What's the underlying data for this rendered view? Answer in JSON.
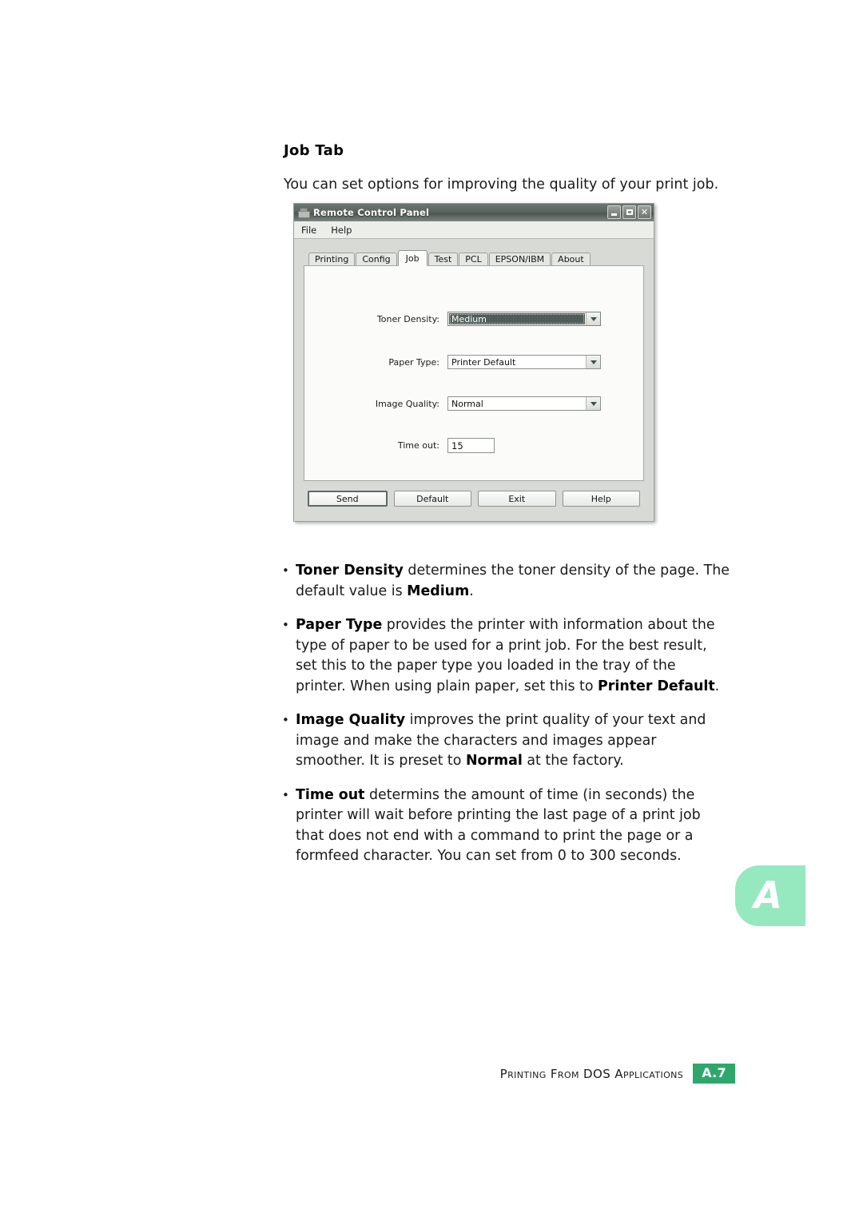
{
  "page": {
    "heading": "Job Tab",
    "intro": "You can set options for improving the quality of your print job."
  },
  "dialog": {
    "title": "Remote Control Panel",
    "title_icon": "printer-icon",
    "window_controls": {
      "minimize": "–",
      "maximize": "□",
      "close": "✕"
    },
    "menu": [
      {
        "label": "File"
      },
      {
        "label": "Help"
      }
    ],
    "tabs": [
      {
        "label": "Printing",
        "active": false
      },
      {
        "label": "Config",
        "active": false
      },
      {
        "label": "Job",
        "active": true
      },
      {
        "label": "Test",
        "active": false
      },
      {
        "label": "PCL",
        "active": false
      },
      {
        "label": "EPSON/IBM",
        "active": false
      },
      {
        "label": "About",
        "active": false
      }
    ],
    "fields": {
      "toner_density": {
        "label": "Toner Density:",
        "value": "Medium",
        "type": "dropdown",
        "focused": true
      },
      "paper_type": {
        "label": "Paper Type:",
        "value": "Printer Default",
        "type": "dropdown",
        "focused": false
      },
      "image_quality": {
        "label": "Image Quality:",
        "value": "Normal",
        "type": "dropdown",
        "focused": false
      },
      "time_out": {
        "label": "Time out:",
        "value": "15",
        "type": "text"
      }
    },
    "buttons": [
      {
        "label": "Send",
        "default": true
      },
      {
        "label": "Default",
        "default": false
      },
      {
        "label": "Exit",
        "default": false
      },
      {
        "label": "Help",
        "default": false
      }
    ]
  },
  "bullets": [
    {
      "id": "toner-density",
      "term": "Toner Density",
      "rest_1": " determines the toner density of the page. The default value is ",
      "term_2": "Medium",
      "rest_2": "."
    },
    {
      "id": "paper-type",
      "term": "Paper Type",
      "rest_1": " provides the printer with information about the type of paper to be used for a print job. For the best result, set this to the paper type you loaded in the tray of the printer. When using plain paper, set this to ",
      "term_2": "Printer Default",
      "rest_2": "."
    },
    {
      "id": "image-quality",
      "term": "Image Quality",
      "rest_1": " improves the print quality of your text and image and make the characters and images appear smoother. It is preset to ",
      "term_2": "Normal",
      "rest_2": " at the factory."
    },
    {
      "id": "time-out",
      "term": "Time out",
      "rest_1": " determins the amount of time (in seconds) the printer will wait before printing the last page of a print job that does not end with a command to print the page or a formfeed character. You can set from 0 to 300 seconds.",
      "term_2": "",
      "rest_2": ""
    }
  ],
  "index_tab": {
    "letter": "A",
    "color": "#96e8bf"
  },
  "footer": {
    "text": "Printing From DOS Applications",
    "page_number": "A.7",
    "badge_color": "#2ea76c"
  }
}
